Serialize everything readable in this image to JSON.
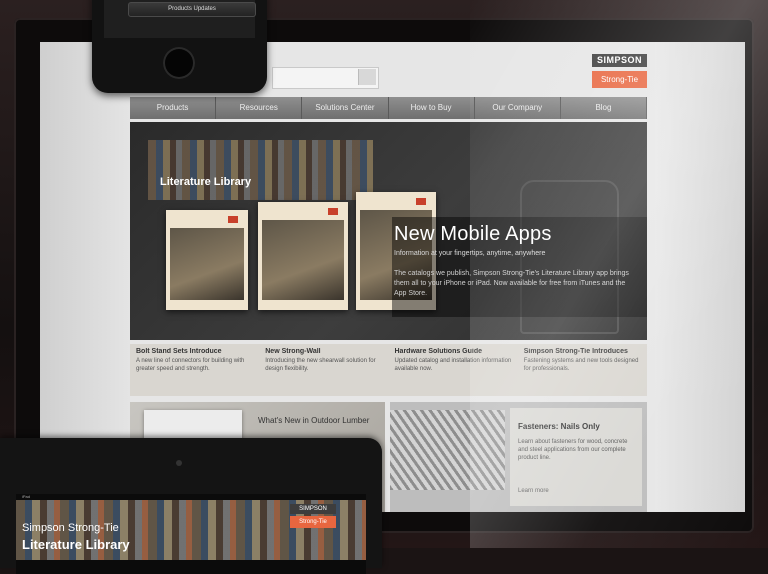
{
  "site": {
    "search_placeholder": "",
    "brand_line1": "SIMPSON",
    "brand_line2": "Strong-Tie"
  },
  "nav": [
    {
      "label": "Products"
    },
    {
      "label": "Resources"
    },
    {
      "label": "Solutions Center"
    },
    {
      "label": "How to Buy"
    },
    {
      "label": "Our Company"
    },
    {
      "label": "Blog"
    }
  ],
  "hero": {
    "shelf_label": "Literature Library",
    "title": "New Mobile Apps",
    "subtitle": "Information at your fingertips, anytime, anywhere",
    "body": "The catalogs we publish, Simpson Strong-Tie's Literature Library app brings them all to your iPhone or iPad. Now available for free from iTunes and the App Store."
  },
  "features": [
    {
      "title": "Bolt Stand Sets Introduce",
      "desc": "A new line of connectors for building with greater speed and strength."
    },
    {
      "title": "New Strong-Wall",
      "desc": "Introducing the new shearwall solution for design flexibility."
    },
    {
      "title": "Hardware Solutions Guide",
      "desc": "Updated catalog and installation information available now."
    },
    {
      "title": "Simpson Strong-Tie Introduces",
      "desc": "Fastening systems and new tools designed for professionals."
    }
  ],
  "promo_left": {
    "text": "What's New in Outdoor Lumber"
  },
  "promo_right": {
    "title": "Fasteners: Nails Only",
    "desc": "Learn about fasteners for wood, concrete and steel applications from our complete product line.",
    "more": "Learn more"
  },
  "phone": {
    "button_label": "Products Updates"
  },
  "tablet": {
    "status": "iPad",
    "line1": "Simpson Strong-Tie",
    "line2": "Literature Library",
    "brand_line1": "SIMPSON",
    "brand_line2": "Strong-Tie"
  }
}
